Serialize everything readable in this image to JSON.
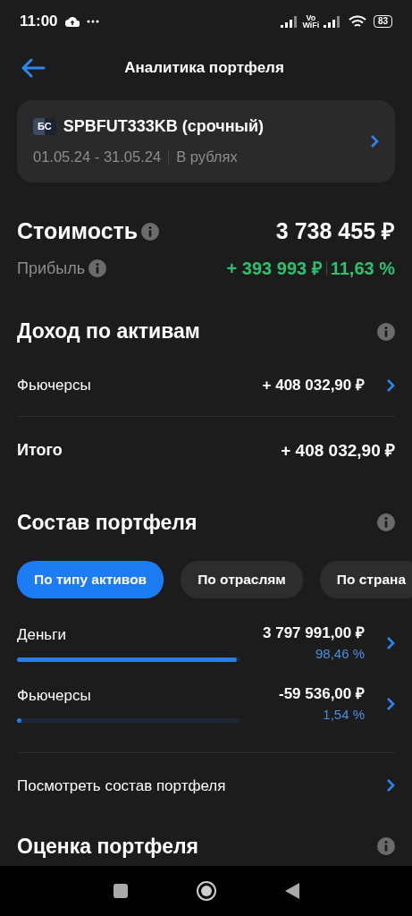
{
  "status_bar": {
    "time": "11:00",
    "vowifi": "Vo WiFi",
    "battery": "83"
  },
  "header": {
    "title": "Аналитика портфеля"
  },
  "account": {
    "logo": "БС",
    "name": "SPBFUT333KB (срочный)",
    "period": "01.05.24 - 31.05.24",
    "currency": "В рублях"
  },
  "value": {
    "label": "Стоимость",
    "amount": "3 738 455 ₽",
    "profit_label": "Прибыль",
    "profit": "+ 393 993 ₽",
    "profit_percent": "11,63 %"
  },
  "income": {
    "title": "Доход по активам",
    "rows": [
      {
        "label": "Фьючерсы",
        "amount": "+ 408 032,90 ₽"
      }
    ],
    "total_label": "Итого",
    "total": "+ 408 032,90 ₽"
  },
  "composition": {
    "title": "Состав портфеля",
    "tabs": [
      {
        "label": "По типу активов",
        "selected": true
      },
      {
        "label": "По отраслям",
        "selected": false
      },
      {
        "label": "По страна",
        "selected": false
      }
    ],
    "rows": [
      {
        "label": "Деньги",
        "amount": "3 797 991,00 ₽",
        "percent": "98,46 %",
        "level": 0.985
      },
      {
        "label": "Фьючерсы",
        "amount": "-59 536,00 ₽",
        "percent": "1,54 %",
        "level": 0.015
      }
    ],
    "link": "Посмотреть состав портфеля"
  },
  "next_section": {
    "title": "Оценка портфеля"
  }
}
